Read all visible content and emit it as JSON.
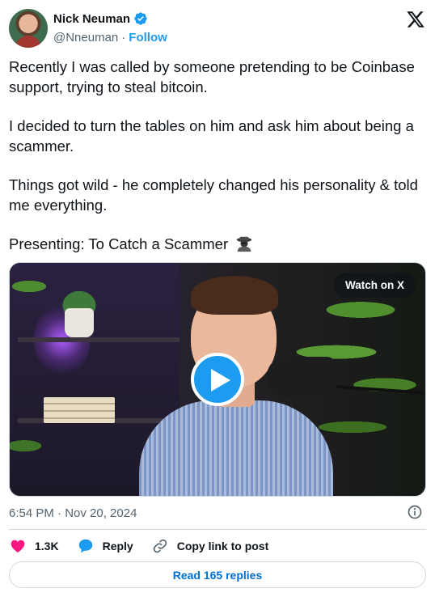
{
  "author": {
    "display_name": "Nick Neuman",
    "handle": "@Nneuman",
    "separator": "·",
    "follow_label": "Follow",
    "verified_color": "#1d9bf0"
  },
  "post": {
    "paragraphs": [
      "Recently I was called by someone pretending to be Coinbase support, trying to steal bitcoin.",
      "I decided to turn the tables on him and ask him about being a scammer.",
      "Things got wild - he completely changed his personality & told me everything."
    ],
    "last_line": "Presenting: To Catch a Scammer",
    "emoji": "detective-emoji"
  },
  "media": {
    "watch_label": "Watch on X",
    "play_icon": "play-icon"
  },
  "meta": {
    "timestamp": "6:54 PM · Nov 20, 2024"
  },
  "actions": {
    "likes_count": "1.3K",
    "reply_label": "Reply",
    "copy_link_label": "Copy link to post"
  },
  "replies_button_label": "Read 165 replies",
  "colors": {
    "accent": "#1d9bf0",
    "like": "#f91880",
    "text": "#0f1419",
    "muted": "#536471",
    "link": "#006fd6"
  }
}
